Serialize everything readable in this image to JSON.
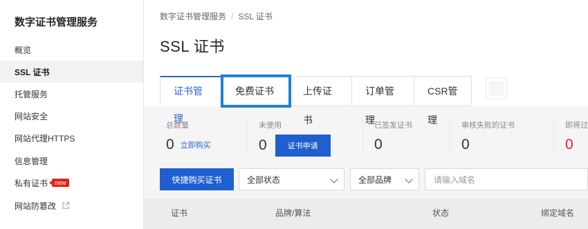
{
  "sidebar": {
    "title": "数字证书管理服务",
    "items": [
      {
        "label": "概览"
      },
      {
        "label": "SSL 证书"
      },
      {
        "label": "托管服务"
      },
      {
        "label": "网站安全"
      },
      {
        "label": "网站代理HTTPS"
      },
      {
        "label": "信息管理"
      },
      {
        "label": "私有证书",
        "badge": "new"
      },
      {
        "label": "网站防篡改"
      }
    ]
  },
  "breadcrumb": {
    "root": "数字证书管理服务",
    "sep": "/",
    "current": "SSL 证书"
  },
  "page_title": "SSL 证书",
  "tabs": [
    {
      "label": "证书管理"
    },
    {
      "label": "免费证书"
    },
    {
      "label": "上传证书"
    },
    {
      "label": "订单管理"
    },
    {
      "label": "CSR管理"
    }
  ],
  "stats": {
    "total": {
      "label": "总数量",
      "value": "0",
      "link": "立即购买"
    },
    "unused": {
      "label": "未使用",
      "value": "0",
      "button": "证书申请"
    },
    "issued": {
      "label": "已签发证书",
      "value": "0"
    },
    "failed": {
      "label": "审核失败的证书",
      "value": "0"
    },
    "expiring": {
      "label": "即将过",
      "value": "0"
    }
  },
  "toolbar": {
    "buy_button": "快捷购买证书",
    "status_select": "全部状态",
    "brand_select": "全部品牌",
    "search_placeholder": "请输入域名"
  },
  "table": {
    "headers": [
      "证书",
      "品牌/算法",
      "状态",
      "绑定域名"
    ]
  },
  "colors": {
    "primary": "#1f5fd0",
    "danger": "#e2231a",
    "highlight": "#1e7fd8"
  }
}
